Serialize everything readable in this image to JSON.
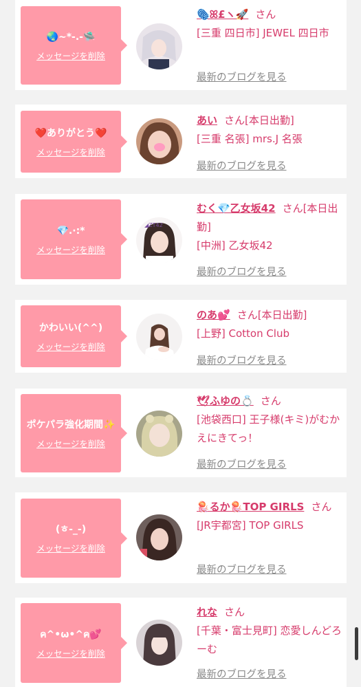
{
  "delete_label": "メッセージを削除",
  "san_label": "さん",
  "blog_label": "最新のブログを見る",
  "colors": {
    "pink": "#ff9aa8",
    "accent": "#d63b6b",
    "link_gray": "#8a8a8a"
  },
  "cards": [
    {
      "message": "🌏~*-.-🛸",
      "name": "🫆ꕤ£ヽ🚀",
      "san": "さん",
      "location": "[三重 四日市] JEWEL 四日市"
    },
    {
      "message": "❤️ありがとう❤️",
      "name": "あい",
      "san": "さん[本日出勤]",
      "location": "[三重 名張] mrs.J 名張"
    },
    {
      "message": "💎.·:*",
      "name": "むく💎乙女坂42",
      "san": "さん[本日出勤]",
      "location": "[中洲] 乙女坂42"
    },
    {
      "message": "かわいい(^^)",
      "name": "のあ💕",
      "san": "さん[本日出勤]",
      "location": "[上野] Cotton Club"
    },
    {
      "message": "ポケパラ強化期間✨",
      "name": "🕊ふゆの💍",
      "san": "さん",
      "location": "[池袋西口] 王子様(キミ)がむかえにきてっ！"
    },
    {
      "message": "(ㅎ-_-)",
      "name": "🪼るか🪼TOP GIRLS",
      "san": "さん",
      "location": "[JR宇都宮] TOP GIRLS"
    },
    {
      "message": "ค^•ω•^ค💕",
      "name": "れな",
      "san": "さん",
      "location": "[千葉・富士見町] 恋愛しんどろーむ"
    }
  ]
}
